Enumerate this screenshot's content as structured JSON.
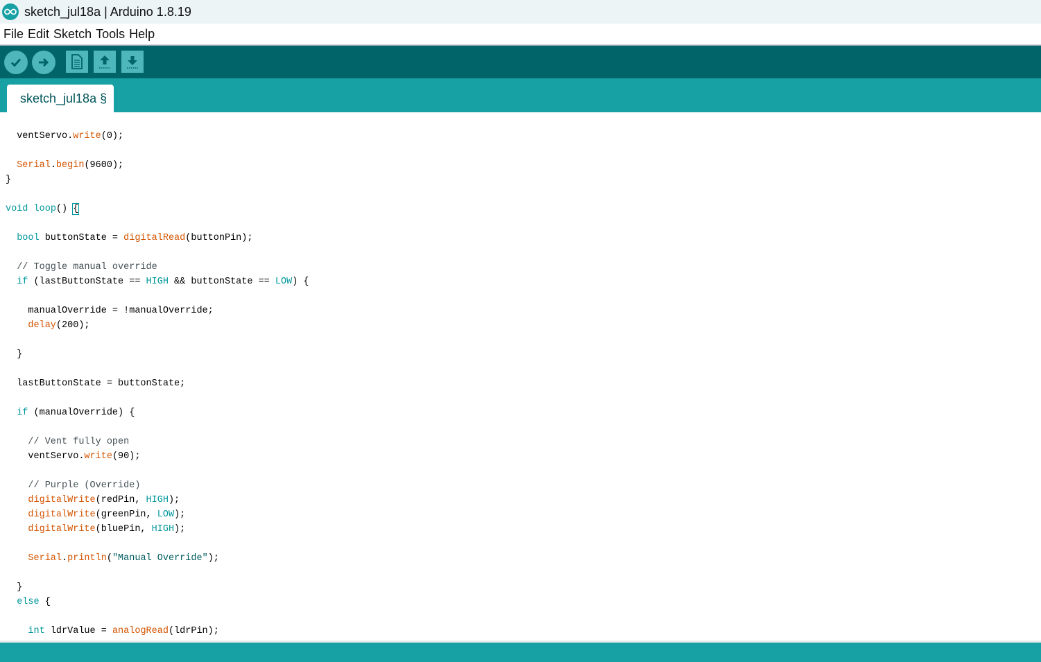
{
  "window": {
    "title": "sketch_jul18a | Arduino 1.8.19",
    "app_icon": "arduino-infinity-icon"
  },
  "menu": [
    "File",
    "Edit",
    "Sketch",
    "Tools",
    "Help"
  ],
  "toolbar": {
    "buttons": [
      {
        "name": "verify",
        "icon": "check-icon"
      },
      {
        "name": "upload",
        "icon": "arrow-right-icon"
      },
      {
        "name": "new",
        "icon": "new-document-icon"
      },
      {
        "name": "open",
        "icon": "arrow-up-icon"
      },
      {
        "name": "save",
        "icon": "arrow-down-icon"
      }
    ]
  },
  "tab": {
    "label": "sketch_jul18a §"
  },
  "colors": {
    "toolbar": "#006468",
    "accent": "#17a1a5",
    "button": "#4db7bb",
    "keyword": "#00979c",
    "function": "#d35400",
    "comment": "#434f54"
  },
  "editor": {
    "lines": [
      [
        {
          "t": "  ventServo."
        },
        {
          "t": "write",
          "c": "fn"
        },
        {
          "t": "(0);"
        }
      ],
      [],
      [
        {
          "t": "  "
        },
        {
          "t": "Serial",
          "c": "fn"
        },
        {
          "t": "."
        },
        {
          "t": "begin",
          "c": "fn"
        },
        {
          "t": "(9600);"
        }
      ],
      [
        {
          "t": "}"
        }
      ],
      [],
      [
        {
          "t": "void",
          "c": "kw"
        },
        {
          "t": " "
        },
        {
          "t": "loop",
          "c": "kw"
        },
        {
          "t": "() "
        },
        {
          "t": "{",
          "c": "caret"
        }
      ],
      [],
      [
        {
          "t": "  "
        },
        {
          "t": "bool",
          "c": "kw"
        },
        {
          "t": " buttonState = "
        },
        {
          "t": "digitalRead",
          "c": "fn"
        },
        {
          "t": "(buttonPin);"
        }
      ],
      [],
      [
        {
          "t": "  // Toggle manual override",
          "c": "cm"
        }
      ],
      [
        {
          "t": "  "
        },
        {
          "t": "if",
          "c": "kw"
        },
        {
          "t": " (lastButtonState == "
        },
        {
          "t": "HIGH",
          "c": "kw"
        },
        {
          "t": " && buttonState == "
        },
        {
          "t": "LOW",
          "c": "kw"
        },
        {
          "t": ") {"
        }
      ],
      [],
      [
        {
          "t": "    manualOverride = !manualOverride;"
        }
      ],
      [
        {
          "t": "    "
        },
        {
          "t": "delay",
          "c": "fn"
        },
        {
          "t": "(200);"
        }
      ],
      [],
      [
        {
          "t": "  }"
        }
      ],
      [],
      [
        {
          "t": "  lastButtonState = buttonState;"
        }
      ],
      [],
      [
        {
          "t": "  "
        },
        {
          "t": "if",
          "c": "kw"
        },
        {
          "t": " (manualOverride) {"
        }
      ],
      [],
      [
        {
          "t": "    // Vent fully open",
          "c": "cm"
        }
      ],
      [
        {
          "t": "    ventServo."
        },
        {
          "t": "write",
          "c": "fn"
        },
        {
          "t": "(90);"
        }
      ],
      [],
      [
        {
          "t": "    // Purple (Override)",
          "c": "cm"
        }
      ],
      [
        {
          "t": "    "
        },
        {
          "t": "digitalWrite",
          "c": "fn"
        },
        {
          "t": "(redPin, "
        },
        {
          "t": "HIGH",
          "c": "kw"
        },
        {
          "t": ");"
        }
      ],
      [
        {
          "t": "    "
        },
        {
          "t": "digitalWrite",
          "c": "fn"
        },
        {
          "t": "(greenPin, "
        },
        {
          "t": "LOW",
          "c": "kw"
        },
        {
          "t": ");"
        }
      ],
      [
        {
          "t": "    "
        },
        {
          "t": "digitalWrite",
          "c": "fn"
        },
        {
          "t": "(bluePin, "
        },
        {
          "t": "HIGH",
          "c": "kw"
        },
        {
          "t": ");"
        }
      ],
      [],
      [
        {
          "t": "    "
        },
        {
          "t": "Serial",
          "c": "fn"
        },
        {
          "t": "."
        },
        {
          "t": "println",
          "c": "fn"
        },
        {
          "t": "("
        },
        {
          "t": "\"Manual Override\"",
          "c": "str"
        },
        {
          "t": ");"
        }
      ],
      [],
      [
        {
          "t": "  }"
        }
      ],
      [
        {
          "t": "  "
        },
        {
          "t": "else",
          "c": "kw"
        },
        {
          "t": " {"
        }
      ],
      [],
      [
        {
          "t": "    "
        },
        {
          "t": "int",
          "c": "kw"
        },
        {
          "t": " ldrValue = "
        },
        {
          "t": "analogRead",
          "c": "fn"
        },
        {
          "t": "(ldrPin);"
        }
      ]
    ]
  }
}
